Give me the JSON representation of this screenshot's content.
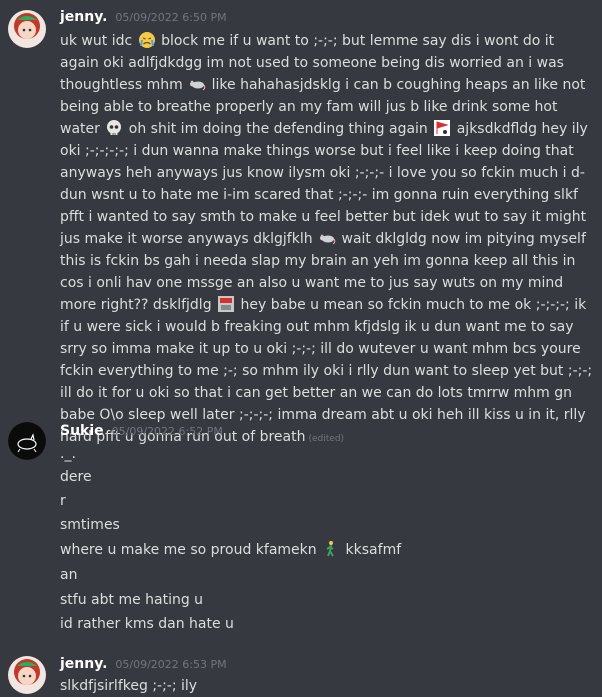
{
  "messages": [
    {
      "username": "jenny.",
      "timestamp": "05/09/2022 6:50 PM",
      "text_parts": [
        "uk wut idc",
        "block me if u want to ;-;-; but lemme say dis i wont do it again oki adlfjdkdgg im not used to someone being dis worried an i was thoughtless mhm",
        "like hahahasjdsklg i can b coughing heaps an like not being able to breathe properly an my fam will jus b like drink some hot water",
        "oh shit im doing the defending thing again",
        "ajksdkdfldg hey ily oki ;-;-;-;-; i dun wanna make things worse but i feel like i keep doing that anyways heh anyways jus know ilysm oki ;-;-;- i love you so fckin much i d-dun wsnt u to hate me i-im scared that ;-;-;- im gonna ruin everything slkf pfft i wanted to say smth to make u feel better but idek wut to say it might jus make it worse anyways dklgjfklh",
        "wait dklgldg now im pitying myself this is fckin bs gah i needa slap my brain an yeh im gonna keep all this in cos i onli hav one mssge an also u want me to jus say wuts on my mind more right?? dsklfjdlg",
        "hey babe u mean so fckin much to me ok ;-;-;-; ik if u were sick i would b freaking out mhm kfjdslg ik u dun want me to say srry so imma make it up to u oki ;-;-; ill do wutever u want mhm bcs youre fckin everything to me ;-; so mhm ily oki i rlly dun want to sleep yet but ;-;-; ill do it for u oki so that i can get better an we can do lots tmrrw mhm gn babe O\\o sleep well later ;-;-;-; imma dream abt u oki heh ill kiss u in it, rlly hard pfft u gonna run out of breath"
      ],
      "edited": "(edited)"
    },
    {
      "username": "Sukie",
      "timestamp": "05/09/2022 6:52 PM",
      "lines": [
        "._.",
        "dere",
        "r",
        "smtimes",
        "where u make me so proud kfamekn",
        "kksafmf",
        "an",
        "stfu abt me hating u",
        "id rather kms dan hate u"
      ]
    },
    {
      "username": "jenny.",
      "timestamp": "05/09/2022 6:53 PM",
      "text": "slkdfjsirlfkeg ;-;-; ily"
    }
  ],
  "icons": {
    "emoji_1": "crying-face-icon",
    "emoji_2": "rat-icon",
    "emoji_3": "skull-icon",
    "emoji_4": "flag-sticker-icon",
    "emoji_5": "rat-icon",
    "emoji_6": "exit-sign-icon",
    "emoji_7": "walking-person-icon"
  },
  "colors": {
    "background": "#36393f",
    "username": "#ffffff",
    "timestamp": "#72767d",
    "text": "#dcddde"
  }
}
